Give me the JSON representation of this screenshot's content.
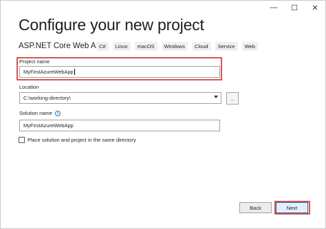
{
  "window": {
    "controls": {
      "minimize": "—",
      "maximize": "☐",
      "close": "✕"
    }
  },
  "title": "Configure your new project",
  "template": {
    "name": "ASP.NET Core Web App",
    "tags": [
      "C#",
      "Linux",
      "macOS",
      "Windows",
      "Cloud",
      "Service",
      "Web"
    ]
  },
  "project_name": {
    "label": "Project name",
    "value": "MyFirstAzureWebApp"
  },
  "location": {
    "label": "Location",
    "value": "C:\\working-directory\\",
    "browse_label": "..."
  },
  "solution_name": {
    "label": "Solution name",
    "value": "MyFirstAzureWebApp",
    "info_icon": "i"
  },
  "same_directory": {
    "label": "Place solution and project in the same directory",
    "checked": false
  },
  "buttons": {
    "back": "Back",
    "next": "Next"
  },
  "colors": {
    "highlight": "#d9534f",
    "accent": "#1a6fb7"
  }
}
